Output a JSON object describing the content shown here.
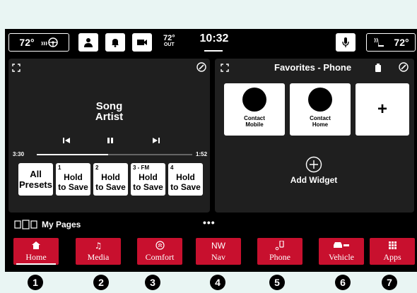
{
  "status": {
    "left_temp": "72°",
    "out_temp": "72°",
    "out_label": "OUT",
    "clock": "10:32",
    "right_temp": "72°"
  },
  "media": {
    "song": "Song",
    "artist": "Artist",
    "time_elapsed": "3:30",
    "time_total": "1:52",
    "progress": 0.46,
    "presets": [
      {
        "num": "",
        "line1": "All",
        "line2": "Presets"
      },
      {
        "num": "1",
        "line1": "Hold",
        "line2": "to Save"
      },
      {
        "num": "2",
        "line1": "Hold",
        "line2": "to Save"
      },
      {
        "num": "3 - FM",
        "line1": "Hold",
        "line2": "to Save"
      },
      {
        "num": "4",
        "line1": "Hold",
        "line2": "to Save"
      }
    ]
  },
  "favorites": {
    "title": "Favorites - Phone",
    "contacts": [
      {
        "line1": "Contact",
        "line2": "Mobile"
      },
      {
        "line1": "Contact",
        "line2": "Home"
      }
    ],
    "add_symbol": "+",
    "add_widget": "Add Widget"
  },
  "pages": {
    "label": "My Pages",
    "dots": "•••"
  },
  "nav": [
    {
      "label": "Home",
      "icon": "home-icon",
      "badge": "1"
    },
    {
      "label": "Media",
      "icon": "music-note-icon",
      "badge": "2"
    },
    {
      "label": "Comfort",
      "icon": "climate-icon",
      "badge": "3"
    },
    {
      "label": "Nav",
      "icon": "compass-icon",
      "icon_text": "NW",
      "badge": "4"
    },
    {
      "label": "Phone",
      "icon": "phone-icon",
      "badge": "5"
    },
    {
      "label": "Vehicle",
      "icon": "car-icon",
      "badge": "6"
    },
    {
      "label": "Apps",
      "icon": "grid-icon",
      "badge": "7"
    }
  ],
  "colors": {
    "nav_red": "#c8102e",
    "panel": "#1f1f1f",
    "background": "#e9f5f3"
  }
}
